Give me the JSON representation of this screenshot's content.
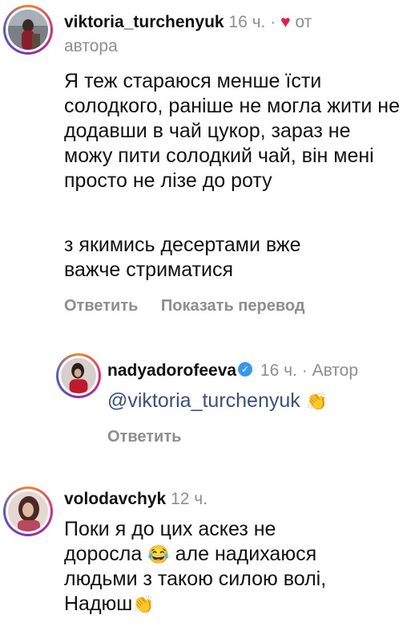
{
  "comments": [
    {
      "username": "viktoria_turchenyuk",
      "time": "16 ч.",
      "separator": "·",
      "heart": "♥",
      "liked_by_author_a": "от",
      "liked_by_author_b": "автора",
      "text": "Я теж стараюся менше їсти солодкого, раніше не могла жити не додавши в чай цукор, зараз не можу пити солодкий чай, він мені просто не лізе до роту",
      "text2": "з якимись десертами вже важче стриматися",
      "reply_label": "Ответить",
      "translate_label": "Показать перевод"
    },
    {
      "username": "nadyadorofeeva",
      "verified": "✓",
      "time": "16 ч.",
      "separator": "·",
      "author_label": "Автор",
      "mention": "@viktoria_turchenyuk",
      "emoji": "👏",
      "reply_label": "Ответить"
    },
    {
      "username": "volodavchyk",
      "time": "12 ч.",
      "text_a": "Поки я до цих аскез не доросла",
      "emoji_laugh": "😂",
      "text_b": "але надихаюся людьми з такою силою волі, Надюш",
      "emoji_clap": "👏"
    }
  ]
}
